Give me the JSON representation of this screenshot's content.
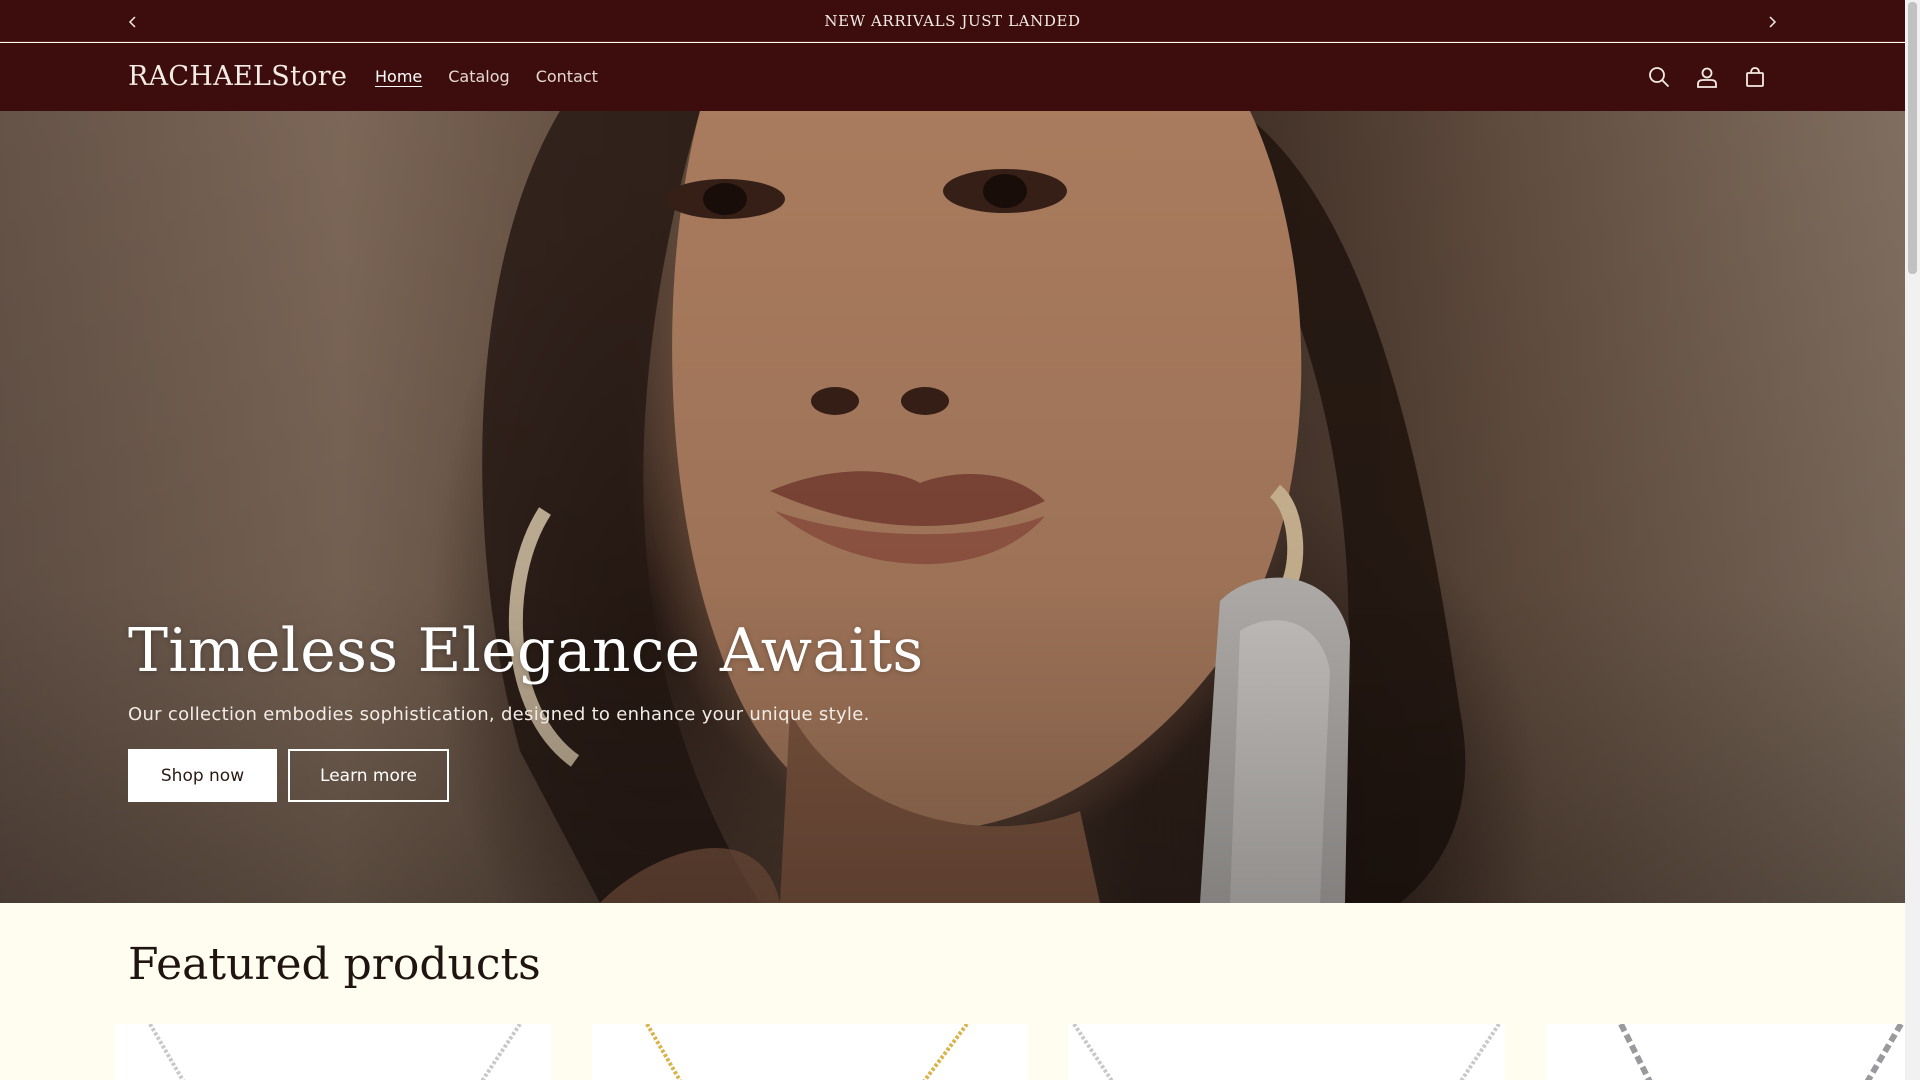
{
  "announcement": {
    "text": "NEW ARRIVALS JUST LANDED",
    "prev_icon": "chevron-left-icon",
    "next_icon": "chevron-right-icon"
  },
  "header": {
    "logo": "RACHAELStore",
    "nav": [
      {
        "label": "Home",
        "active": true
      },
      {
        "label": "Catalog",
        "active": false
      },
      {
        "label": "Contact",
        "active": false
      }
    ],
    "icons": [
      "search-icon",
      "account-icon",
      "cart-icon"
    ]
  },
  "hero": {
    "title": "Timeless Elegance Awaits",
    "subtitle": "Our collection embodies sophistication, designed to enhance your unique style.",
    "primary_button": "Shop now",
    "secondary_button": "Learn more"
  },
  "featured": {
    "title": "Featured products",
    "products": [
      {
        "chain_color": "#c8c8cc"
      },
      {
        "chain_color": "#d9b24a"
      },
      {
        "chain_color": "#c8c8cc"
      },
      {
        "chain_color": "#9a9a9e"
      }
    ]
  },
  "colors": {
    "brand_dark": "#3d0d0d",
    "page_background": "#fffdf0",
    "text_light": "#f4ece4"
  }
}
